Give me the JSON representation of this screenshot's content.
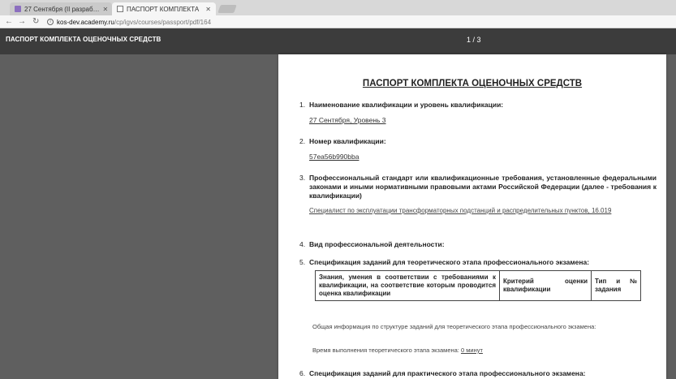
{
  "browser": {
    "tabs": [
      {
        "title": "27 Сентября (II разраб…",
        "active": false
      },
      {
        "title": "ПАСПОРТ КОМПЛЕКТА",
        "active": true
      }
    ],
    "nav_buttons": {
      "back": "←",
      "forward": "→",
      "reload": "↻"
    },
    "close_glyph": "✕",
    "url": {
      "host": "kos-dev.academy.ru",
      "path": "/cp/igvs/courses/passport/pdf/164"
    }
  },
  "pdf_toolbar": {
    "title": "ПАСПОРТ КОМПЛЕКТА ОЦЕНОЧНЫХ СРЕДСТВ",
    "page_indicator": "1 / 3"
  },
  "document": {
    "title": "ПАСПОРТ КОМПЛЕКТА ОЦЕНОЧНЫХ СРЕДСТВ",
    "sec1": {
      "num": "1.",
      "heading": "Наименование квалификации и уровень квалификации:",
      "value": "27 Сентября, Уровень 3"
    },
    "sec2": {
      "num": "2.",
      "heading": "Номер квалификации:",
      "value": "57ea56b990bba"
    },
    "sec3": {
      "num": "3.",
      "heading": "Профессиональный стандарт или квалификационные требования, установленные федеральными законами и иными нормативными правовыми актами Российской Федерации (далее - требования к квалификации)",
      "value": "Специалист по эксплуатации трансформаторных подстанций и распределительных пунктов, 16.019"
    },
    "sec4": {
      "num": "4.",
      "heading": "Вид профессиональной деятельности:"
    },
    "sec5": {
      "num": "5.",
      "heading": "Спецификация заданий для теоретического этапа профессионального экзамена:",
      "table_headers": [
        "Знания, умения в соответствии с требованиями к квалификации, на соответствие которым проводится оценка квалификации",
        "Критерий оценки квалификации",
        "Тип и № задания"
      ],
      "note": "Общая информация по структуре заданий для теоретического этапа профессионального экзамена:",
      "time_label": "Время выполнения теоретического этапа экзамена: ",
      "time_value": "0 минут"
    },
    "sec6": {
      "num": "6.",
      "heading": "Спецификация заданий для практического этапа профессионального экзамена:"
    }
  }
}
